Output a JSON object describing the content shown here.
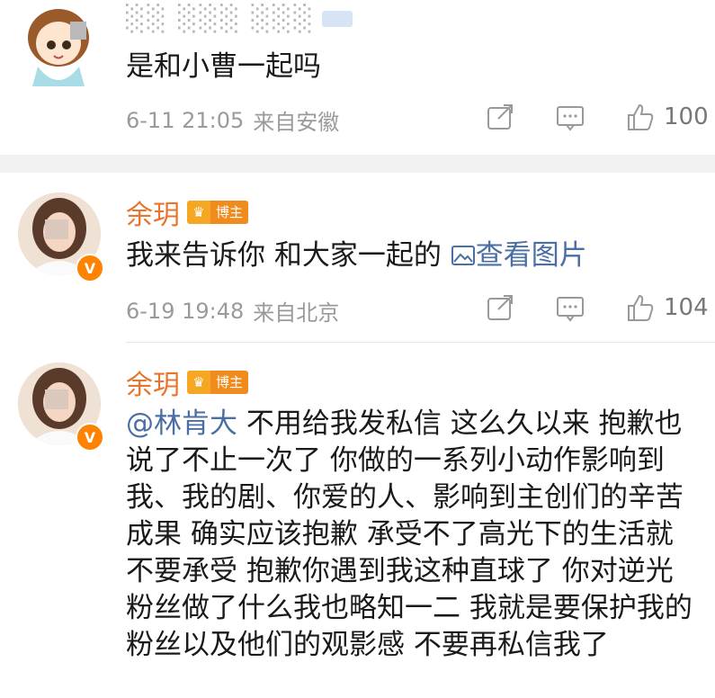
{
  "post1": {
    "username": "░░ ░░░ ░░░",
    "content": "是和小曹一起吗",
    "time": "6-11 21:05",
    "source": "来自安徽",
    "like_count": "100",
    "avatar_icon": "cartoon-girl-avatar-icon"
  },
  "post2": {
    "username": "余玥",
    "badge": "博主",
    "content_text": "我来告诉你 和大家一起的 ",
    "image_link": "查看图片",
    "time": "6-19 19:48",
    "source": "来自北京",
    "like_count": "104"
  },
  "post3": {
    "username": "余玥",
    "badge": "博主",
    "mention": "@林肯大",
    "lines": [
      " 不用给我发私信 这么久以来 抱歉也",
      "说了不止一次了 你做的一系列小动作影响到",
      "我、我的剧、你爱的人、影响到主创们的辛苦",
      "成果 确实应该抱歉 承受不了高光下的生活就",
      "不要承受 抱歉你遇到我这种直球了 你对逆光",
      "粉丝做了什么我也略知一二 我就是要保护我的",
      "粉丝以及他们的观影感 不要再私信我了"
    ]
  },
  "colors": {
    "username": "#e8742e",
    "link": "#4a6fa5",
    "meta": "#9a9a9a",
    "divider": "#f2f2f2"
  }
}
